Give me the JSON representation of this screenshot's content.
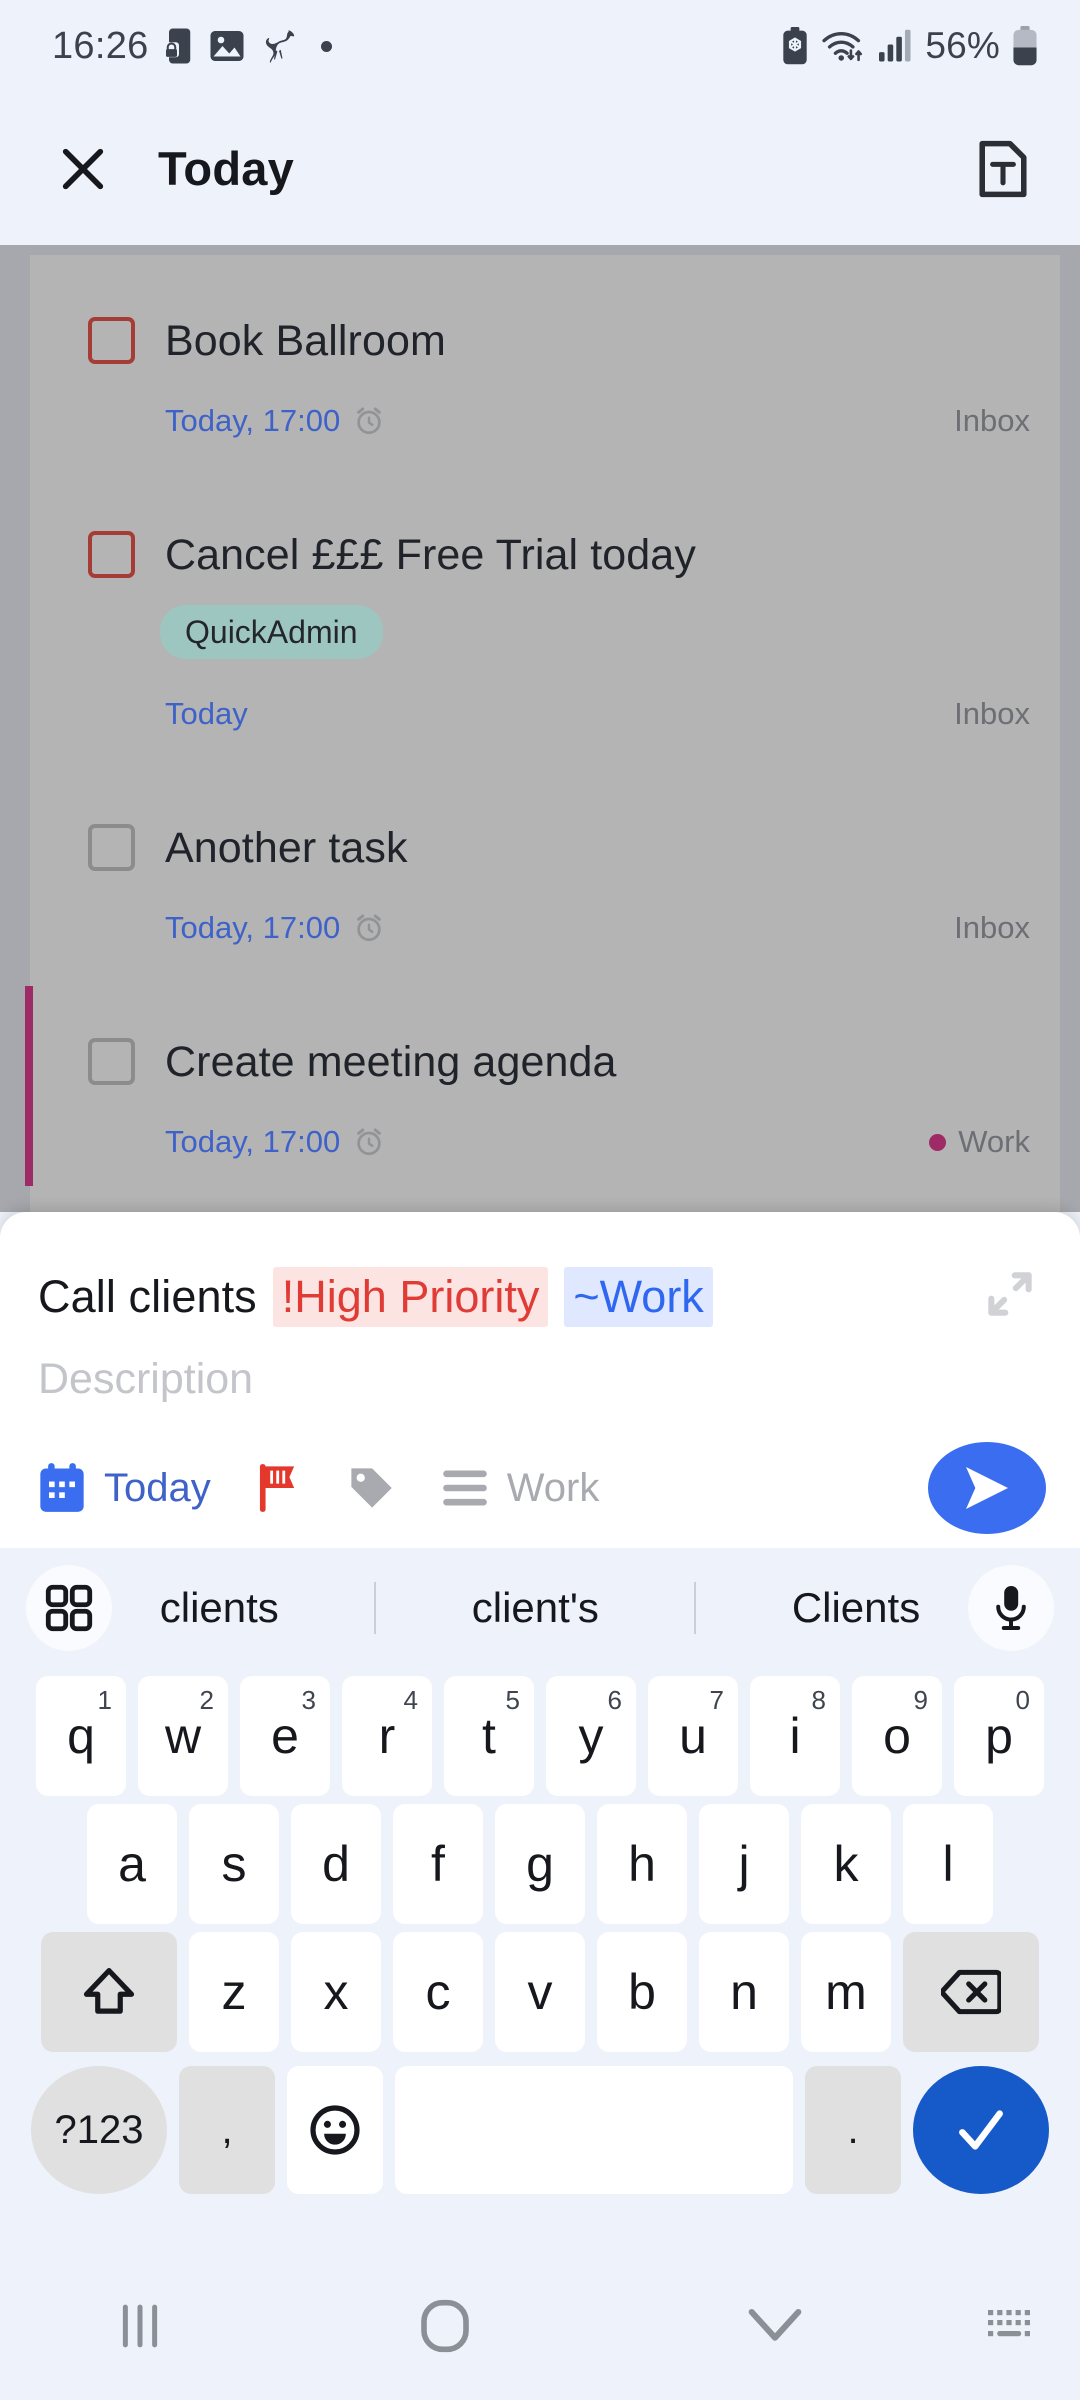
{
  "statusbar": {
    "time": "16:26",
    "battery_percent": "56%",
    "icons": [
      "lock-screen-icon",
      "image-icon",
      "horse-icon",
      "dot-icon",
      "battery-saver-icon",
      "wifi-icon",
      "cellular-signal-icon",
      "battery-icon"
    ]
  },
  "header": {
    "close_label": "close-icon",
    "title": "Today",
    "note_icon": "text-note-icon"
  },
  "tasks": [
    {
      "title": "Book Ballroom",
      "due": "Today, 17:00",
      "has_alarm": true,
      "project": "Inbox",
      "project_color": "",
      "checkbox_color": "#a53c35",
      "label": "",
      "bar_color": ""
    },
    {
      "title": "Cancel £££ Free Trial today",
      "due": "Today",
      "has_alarm": false,
      "project": "Inbox",
      "project_color": "",
      "checkbox_color": "#a53c35",
      "label": "QuickAdmin",
      "bar_color": ""
    },
    {
      "title": "Another task",
      "due": "Today, 17:00",
      "has_alarm": true,
      "project": "Inbox",
      "project_color": "",
      "checkbox_color": "#8c8c8c",
      "label": "",
      "bar_color": ""
    },
    {
      "title": "Create meeting agenda",
      "due": "Today, 17:00",
      "has_alarm": true,
      "project": "Work",
      "project_color": "#9e2a66",
      "checkbox_color": "#8c8c8c",
      "label": "",
      "bar_color": "#9e2a66"
    }
  ],
  "quick_add": {
    "text": "Call clients",
    "token_priority": "!High Priority",
    "token_project": "~Work",
    "description_placeholder": "Description",
    "expand_icon": "expand-icon",
    "tools": {
      "date_label": "Today",
      "priority_icon": "flag-icon",
      "tag_icon": "tag-icon",
      "list_label": "Work",
      "send_icon": "send-icon"
    }
  },
  "keyboard": {
    "suggestions": [
      "clients",
      "client's",
      "Clients"
    ],
    "toolbar_left_icon": "keyboard-menu-icon",
    "toolbar_right_icon": "microphone-icon",
    "row1": [
      {
        "letter": "q",
        "num": "1"
      },
      {
        "letter": "w",
        "num": "2"
      },
      {
        "letter": "e",
        "num": "3"
      },
      {
        "letter": "r",
        "num": "4"
      },
      {
        "letter": "t",
        "num": "5"
      },
      {
        "letter": "y",
        "num": "6"
      },
      {
        "letter": "u",
        "num": "7"
      },
      {
        "letter": "i",
        "num": "8"
      },
      {
        "letter": "o",
        "num": "9"
      },
      {
        "letter": "p",
        "num": "0"
      }
    ],
    "row2": [
      "a",
      "s",
      "d",
      "f",
      "g",
      "h",
      "j",
      "k",
      "l"
    ],
    "row3": [
      "z",
      "x",
      "c",
      "v",
      "b",
      "n",
      "m"
    ],
    "shift_icon": "shift-icon",
    "backspace_icon": "backspace-icon",
    "symbols_label": "?123",
    "comma_label": ",",
    "emoji_icon": "emoji-icon",
    "space_label": "",
    "period_label": ".",
    "enter_icon": "checkmark-icon"
  },
  "navbar": {
    "recents_icon": "recents-icon",
    "home_icon": "home-icon",
    "back_icon": "hide-keyboard-icon",
    "keyboard_icon": "keyboard-switch-icon"
  },
  "colors": {
    "accent_blue": "#3a6df0",
    "link_blue": "#3f62c9",
    "priority_red": "#e03b34",
    "work_magenta": "#9e2a66",
    "chip_teal": "#9ec6c0",
    "bg": "#eef2fb"
  }
}
